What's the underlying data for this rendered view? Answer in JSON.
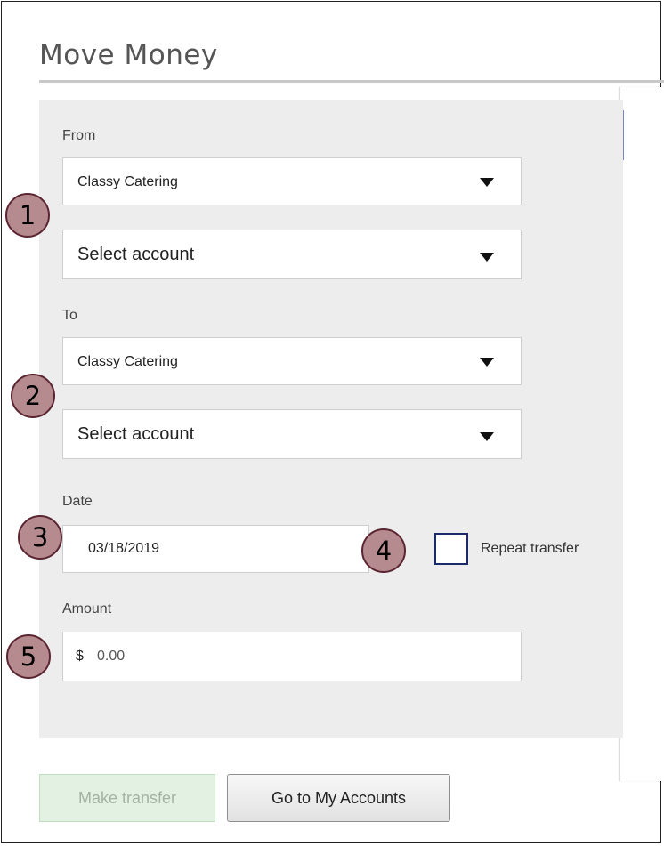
{
  "page": {
    "title": "Move Money"
  },
  "from": {
    "label": "From",
    "business_value": "Classy Catering",
    "account_value": "Select account"
  },
  "to": {
    "label": "To",
    "business_value": "Classy Catering",
    "account_value": "Select account"
  },
  "date": {
    "label": "Date",
    "value": "03/18/2019"
  },
  "repeat": {
    "label": "Repeat transfer",
    "checked": false
  },
  "amount": {
    "label": "Amount",
    "currency": "$",
    "value": "0.00"
  },
  "buttons": {
    "make_transfer": "Make transfer",
    "go_to_accounts": "Go to My Accounts"
  },
  "callouts": [
    "1",
    "2",
    "3",
    "4",
    "5"
  ],
  "colors": {
    "callout_fill": "#b58b8f",
    "callout_border": "#5a2430",
    "side_accent": "#7486c6"
  }
}
